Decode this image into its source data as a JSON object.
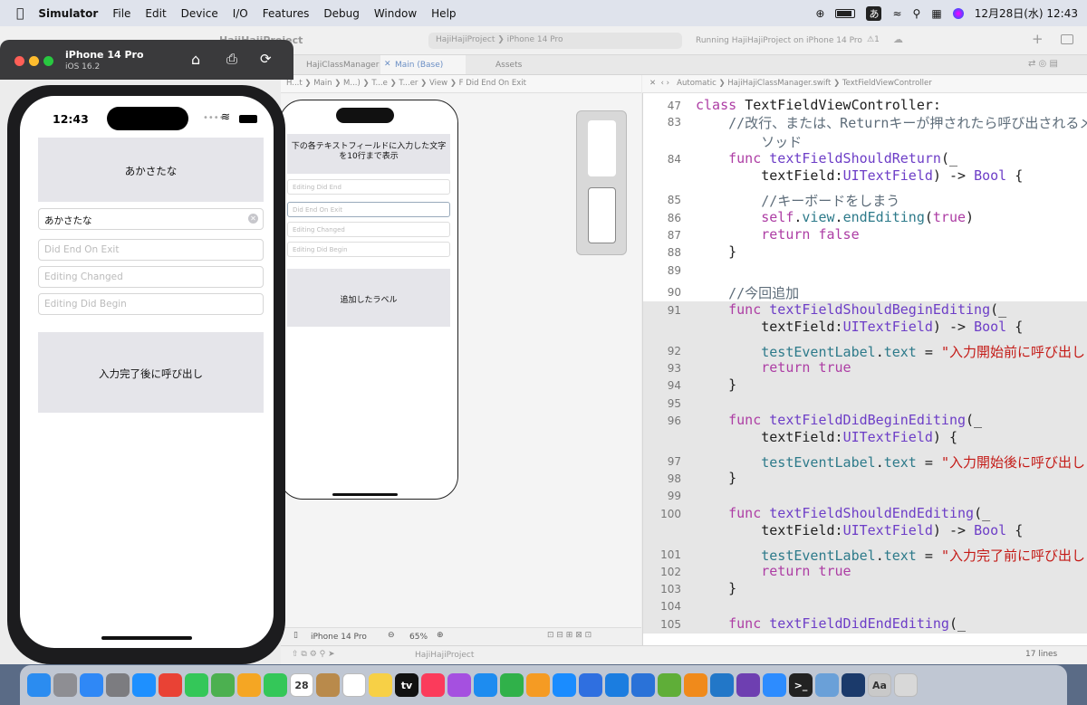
{
  "menubar": {
    "app": "Simulator",
    "items": [
      "File",
      "Edit",
      "Device",
      "I/O",
      "Features",
      "Debug",
      "Window",
      "Help"
    ],
    "ime": "あ",
    "datetime": "12月28日(水) 12:43"
  },
  "xcode": {
    "project": "HajiHajiProject",
    "breadcrumb_device": "iPhone 14 Pro",
    "status": "Running HajiHajiProject on iPhone 14 Pro",
    "warnings": "1",
    "tabs": [
      "HajiClassManager",
      "Main (Base)",
      "Assets"
    ],
    "jump_left": [
      "H...t",
      "Main",
      "M...)",
      "T...e",
      "T...er",
      "View",
      "Did End On Exit"
    ],
    "jump_right": [
      "Automatic",
      "HajiHajiClassManager.swift",
      "TextFieldViewController"
    ],
    "canvas": {
      "header": "下の各テキストフィールドに入力した文字を10行まで表示",
      "fields": [
        "Editing Did End",
        "Did End On Exit",
        "Editing Changed",
        "Editing Did Begin"
      ],
      "label": "追加したラベル",
      "device": "iPhone 14 Pro",
      "zoom": "65%"
    },
    "footer": {
      "project": "HajiHajiProject",
      "lines": "17 lines"
    }
  },
  "code": [
    {
      "n": "47",
      "parts": [
        [
          "kw",
          "class "
        ],
        [
          "tx",
          "TextFieldViewController:"
        ]
      ]
    },
    {
      "n": "83",
      "parts": [
        [
          "cm",
          "    //改行、または、Returnキーが押されたら呼び出されるメ"
        ]
      ]
    },
    {
      "n": "",
      "parts": [
        [
          "cm",
          "        ソッド"
        ]
      ]
    },
    {
      "n": "84",
      "parts": [
        [
          "kw",
          "    func "
        ],
        [
          "fn",
          "textFieldShouldReturn"
        ],
        [
          "tx",
          "(_"
        ]
      ]
    },
    {
      "n": "",
      "parts": [
        [
          "tx",
          "        textField:"
        ],
        [
          "ty",
          "UITextField"
        ],
        [
          "tx",
          ") -> "
        ],
        [
          "ty",
          "Bool"
        ],
        [
          "tx",
          " {"
        ]
      ]
    },
    {
      "n": "85",
      "parts": [
        [
          "cm",
          "        //キーボードをしまう"
        ]
      ]
    },
    {
      "n": "86",
      "parts": [
        [
          "kw",
          "        self"
        ],
        [
          "tx",
          "."
        ],
        [
          "pr",
          "view"
        ],
        [
          "tx",
          "."
        ],
        [
          "pr",
          "endEditing"
        ],
        [
          "tx",
          "("
        ],
        [
          "kw",
          "true"
        ],
        [
          "tx",
          ")"
        ]
      ]
    },
    {
      "n": "87",
      "parts": [
        [
          "kw",
          "        return false"
        ]
      ]
    },
    {
      "n": "88",
      "parts": [
        [
          "tx",
          "    }"
        ]
      ]
    },
    {
      "n": "89",
      "parts": [
        [
          "tx",
          ""
        ]
      ]
    },
    {
      "n": "90",
      "parts": [
        [
          "cm",
          "    //今回追加"
        ]
      ]
    },
    {
      "n": "91",
      "hl": true,
      "parts": [
        [
          "kw",
          "    func "
        ],
        [
          "fn",
          "textFieldShouldBeginEditing"
        ],
        [
          "tx",
          "(_"
        ]
      ]
    },
    {
      "n": "",
      "hl": true,
      "parts": [
        [
          "tx",
          "        textField:"
        ],
        [
          "ty",
          "UITextField"
        ],
        [
          "tx",
          ") -> "
        ],
        [
          "ty",
          "Bool"
        ],
        [
          "tx",
          " {"
        ]
      ]
    },
    {
      "n": "92",
      "hl": true,
      "parts": [
        [
          "pr",
          "        testEventLabel"
        ],
        [
          "tx",
          "."
        ],
        [
          "pr",
          "text"
        ],
        [
          "tx",
          " = "
        ],
        [
          "st",
          "\"入力開始前に呼び出し\""
        ]
      ]
    },
    {
      "n": "93",
      "hl": true,
      "parts": [
        [
          "kw",
          "        return true"
        ]
      ]
    },
    {
      "n": "94",
      "hl": true,
      "parts": [
        [
          "tx",
          "    }"
        ]
      ]
    },
    {
      "n": "95",
      "hl": true,
      "parts": [
        [
          "tx",
          ""
        ]
      ]
    },
    {
      "n": "96",
      "hl": true,
      "parts": [
        [
          "kw",
          "    func "
        ],
        [
          "fn",
          "textFieldDidBeginEditing"
        ],
        [
          "tx",
          "(_"
        ]
      ]
    },
    {
      "n": "",
      "hl": true,
      "parts": [
        [
          "tx",
          "        textField:"
        ],
        [
          "ty",
          "UITextField"
        ],
        [
          "tx",
          ") {"
        ]
      ]
    },
    {
      "n": "97",
      "hl": true,
      "parts": [
        [
          "pr",
          "        testEventLabel"
        ],
        [
          "tx",
          "."
        ],
        [
          "pr",
          "text"
        ],
        [
          "tx",
          " = "
        ],
        [
          "st",
          "\"入力開始後に呼び出し\""
        ]
      ]
    },
    {
      "n": "98",
      "hl": true,
      "parts": [
        [
          "tx",
          "    }"
        ]
      ]
    },
    {
      "n": "99",
      "hl": true,
      "parts": [
        [
          "tx",
          ""
        ]
      ]
    },
    {
      "n": "100",
      "hl": true,
      "parts": [
        [
          "kw",
          "    func "
        ],
        [
          "fn",
          "textFieldShouldEndEditing"
        ],
        [
          "tx",
          "(_"
        ]
      ]
    },
    {
      "n": "",
      "hl": true,
      "parts": [
        [
          "tx",
          "        textField:"
        ],
        [
          "ty",
          "UITextField"
        ],
        [
          "tx",
          ") -> "
        ],
        [
          "ty",
          "Bool"
        ],
        [
          "tx",
          " {"
        ]
      ]
    },
    {
      "n": "101",
      "hl": true,
      "parts": [
        [
          "pr",
          "        testEventLabel"
        ],
        [
          "tx",
          "."
        ],
        [
          "pr",
          "text"
        ],
        [
          "tx",
          " = "
        ],
        [
          "st",
          "\"入力完了前に呼び出し\""
        ]
      ]
    },
    {
      "n": "102",
      "hl": true,
      "parts": [
        [
          "kw",
          "        return true"
        ]
      ]
    },
    {
      "n": "103",
      "hl": true,
      "parts": [
        [
          "tx",
          "    }"
        ]
      ]
    },
    {
      "n": "104",
      "hl": true,
      "parts": [
        [
          "tx",
          ""
        ]
      ]
    },
    {
      "n": "105",
      "hl": true,
      "parts": [
        [
          "kw",
          "    func "
        ],
        [
          "fn",
          "textFieldDidEndEditing"
        ],
        [
          "tx",
          "(_"
        ]
      ]
    }
  ],
  "simulator": {
    "device": "iPhone 14 Pro",
    "os": "iOS 16.2",
    "time": "12:43",
    "top_label": "あかさたな",
    "input_value": "あかさたな",
    "fields": [
      "Did End On Exit",
      "Editing Changed",
      "Editing Did Begin"
    ],
    "bottom_label": "入力完了後に呼び出し"
  },
  "dock": [
    {
      "name": "finder",
      "color": "#2b8cf0",
      "label": ""
    },
    {
      "name": "launchpad",
      "color": "#8e8e93",
      "label": ""
    },
    {
      "name": "mail",
      "color": "#2f88f6",
      "label": ""
    },
    {
      "name": "system-settings",
      "color": "#7c7c80",
      "label": ""
    },
    {
      "name": "safari",
      "color": "#1e90ff",
      "label": ""
    },
    {
      "name": "chrome",
      "color": "#e94235",
      "label": ""
    },
    {
      "name": "messages",
      "color": "#34c759",
      "label": ""
    },
    {
      "name": "maps",
      "color": "#4cb050",
      "label": ""
    },
    {
      "name": "photos",
      "color": "#f5a623",
      "label": ""
    },
    {
      "name": "facetime",
      "color": "#34c759",
      "label": ""
    },
    {
      "name": "calendar",
      "color": "#ffffff",
      "label": "28"
    },
    {
      "name": "notes-brown",
      "color": "#b98a4b",
      "label": ""
    },
    {
      "name": "reminders",
      "color": "#ffffff",
      "label": ""
    },
    {
      "name": "notes",
      "color": "#f7d046",
      "label": ""
    },
    {
      "name": "tv",
      "color": "#111111",
      "label": "tv"
    },
    {
      "name": "music",
      "color": "#fb3b5b",
      "label": ""
    },
    {
      "name": "podcasts",
      "color": "#a550e0",
      "label": ""
    },
    {
      "name": "keynote",
      "color": "#1d8cf0",
      "label": ""
    },
    {
      "name": "numbers",
      "color": "#30b14a",
      "label": ""
    },
    {
      "name": "pages",
      "color": "#f59b23",
      "label": ""
    },
    {
      "name": "app-store",
      "color": "#1a8cff",
      "label": ""
    },
    {
      "name": "simulator-app",
      "color": "#2f6fe0",
      "label": ""
    },
    {
      "name": "xcode",
      "color": "#1b7de0",
      "label": ""
    },
    {
      "name": "instruments",
      "color": "#2a72d8",
      "label": ""
    },
    {
      "name": "grapher",
      "color": "#5fae38",
      "label": ""
    },
    {
      "name": "books",
      "color": "#f08a1b",
      "label": ""
    },
    {
      "name": "vscode",
      "color": "#2277c8",
      "label": ""
    },
    {
      "name": "github-desktop",
      "color": "#6e3fb1",
      "label": ""
    },
    {
      "name": "zoom",
      "color": "#2d8cff",
      "label": ""
    },
    {
      "name": "terminal",
      "color": "#222222",
      "label": ">_"
    },
    {
      "name": "preview",
      "color": "#6aa0d8",
      "label": ""
    },
    {
      "name": "affinity",
      "color": "#1b3a6b",
      "label": ""
    },
    {
      "name": "font-book",
      "color": "#c9c9c9",
      "label": "Aa"
    },
    {
      "name": "trash",
      "color": "#d8d8d8",
      "label": ""
    }
  ]
}
